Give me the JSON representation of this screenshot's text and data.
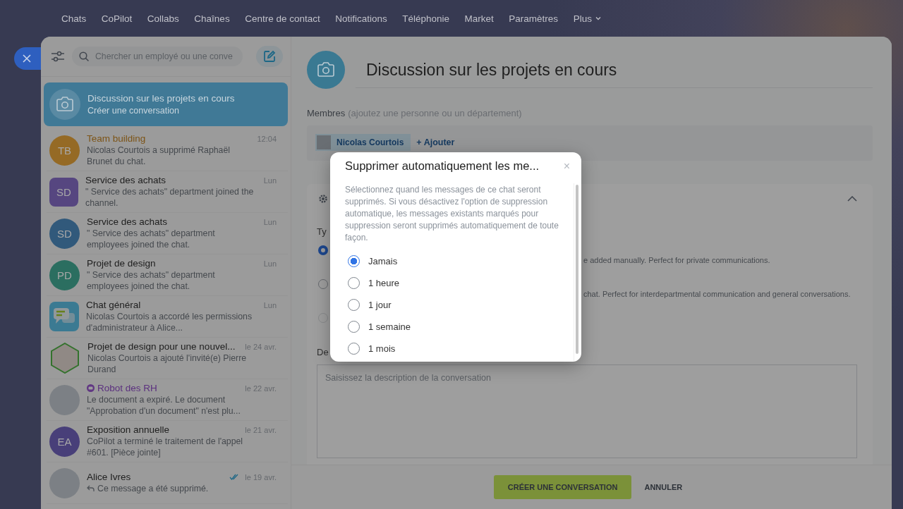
{
  "nav": {
    "items": [
      {
        "label": "Chats",
        "kind": "link"
      },
      {
        "label": "CoPilot",
        "kind": "link"
      },
      {
        "label": "Collabs",
        "kind": "link"
      },
      {
        "label": "Chaînes",
        "kind": "link"
      },
      {
        "label": "Centre de contact",
        "kind": "link"
      },
      {
        "label": "Notifications",
        "kind": "link"
      },
      {
        "label": "Téléphonie",
        "kind": "link"
      },
      {
        "label": "Market",
        "kind": "link"
      },
      {
        "label": "Paramètres",
        "kind": "link"
      },
      {
        "label": "Plus",
        "kind": "menu"
      }
    ]
  },
  "sidebar": {
    "search": {
      "placeholder": "Chercher un employé ou une conve"
    },
    "draft": {
      "title": "Discussion sur les projets en cours",
      "subtitle": "Créer une conversation",
      "selected": true
    },
    "chats": [
      {
        "title": "Team building",
        "kind": "highlight",
        "time": "12:04",
        "preview": "Nicolas Courtois a supprimé Raphaël Brunet du chat.",
        "read": false,
        "reply": false,
        "avatar": {
          "kind": "initials",
          "initials": "TB",
          "color": "#956a25"
        }
      },
      {
        "title": "Service des achats",
        "kind": "plain",
        "time": "Lun",
        "preview": "\" Service des achats\" department joined the channel.",
        "read": false,
        "reply": false,
        "avatar": {
          "kind": "initials-square",
          "initials": "SD",
          "color": "#564680"
        }
      },
      {
        "title": "Service des achats",
        "kind": "plain",
        "time": "Lun",
        "preview": "\" Service des achats\" department employees joined the chat.",
        "read": false,
        "reply": false,
        "avatar": {
          "kind": "initials",
          "initials": "SD",
          "color": "#31597b"
        }
      },
      {
        "title": "Projet de design",
        "kind": "plain",
        "time": "Lun",
        "preview": "\" Service des achats\" department employees joined the chat.",
        "read": false,
        "reply": false,
        "avatar": {
          "kind": "initials",
          "initials": "PD",
          "color": "#2b6e60"
        }
      },
      {
        "title": "Chat général",
        "kind": "plain",
        "time": "Lun",
        "preview": "Nicolas Courtois a accordé les permissions d'administrateur à Alice...",
        "read": false,
        "reply": false,
        "avatar": {
          "kind": "chat-icon"
        }
      },
      {
        "title": "Projet de design pour une nouvel...",
        "kind": "plain",
        "time": "le 24 avr.",
        "preview": "Nicolas Courtois a ajouté l'invité(e) Pierre Durand",
        "read": false,
        "reply": false,
        "avatar": {
          "kind": "image"
        }
      },
      {
        "title": "Robot des RH",
        "kind": "bot",
        "time": "le 22 avr.",
        "preview": "Le document a expiré. Le document \"Approbation d'un document\" n'est plu...",
        "read": false,
        "reply": false,
        "avatar": {
          "kind": "photo"
        }
      },
      {
        "title": "Exposition annuelle",
        "kind": "plain",
        "time": "le 21 avr.",
        "preview": "CoPilot a terminé le traitement de l'appel #601. [Pièce jointe]",
        "read": false,
        "reply": false,
        "avatar": {
          "kind": "initials",
          "initials": "EA",
          "color": "#483f79"
        }
      },
      {
        "title": "Alice Ivres",
        "kind": "plain",
        "time": "le 19 avr.",
        "preview": "Ce message a été supprimé.",
        "read": true,
        "reply": true,
        "avatar": {
          "kind": "photo"
        }
      }
    ]
  },
  "conversation": {
    "title": "Discussion sur les projets en cours",
    "members_label": "Membres",
    "members_hint": "(ajoutez une personne ou un département)",
    "members": [
      {
        "name": "Nicolas Courtois"
      }
    ],
    "add_label": "+ Ajouter",
    "settings": {
      "expanded": true,
      "type_label": "Ty",
      "options": [
        {
          "selected": true,
          "disabled": false,
          "description": "e added manually. Perfect for private communications."
        },
        {
          "selected": false,
          "disabled": false,
          "description": "chat. Perfect for interdepartmental communication and general conversations."
        },
        {
          "selected": false,
          "disabled": true
        }
      ],
      "description_label": "De",
      "description_placeholder": "Saisissez la description de la conversation"
    }
  },
  "footer": {
    "buttons": [
      {
        "label": "CRÉER UNE CONVERSATION",
        "kind": "primary"
      },
      {
        "label": "ANNULER",
        "kind": "link"
      }
    ]
  },
  "dialog": {
    "title": "Supprimer automatiquement les me...",
    "close": "×",
    "text": "Sélectionnez quand les messages de ce chat seront supprimés. Si vous désactivez l'option de suppression automatique, les messages existants marqués pour suppression seront supprimés automatiquement de toute façon.",
    "options": [
      {
        "label": "Jamais",
        "selected": true
      },
      {
        "label": "1 heure",
        "selected": false
      },
      {
        "label": "1 jour",
        "selected": false
      },
      {
        "label": "1 semaine",
        "selected": false
      },
      {
        "label": "1 mois",
        "selected": false
      }
    ]
  }
}
